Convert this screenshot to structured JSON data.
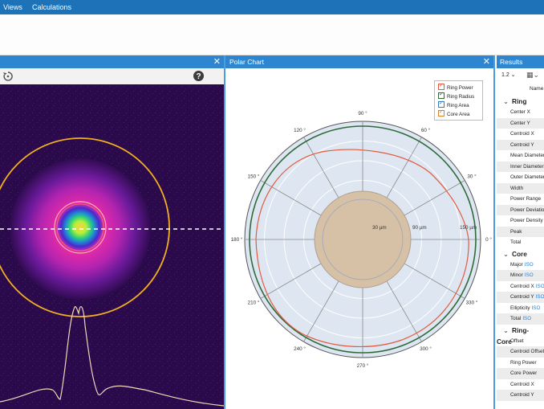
{
  "menu": {
    "items": [
      "Views",
      "Calculations"
    ]
  },
  "left_panel": {
    "close": "✕"
  },
  "polar_panel": {
    "title": "Polar Chart",
    "close": "✕",
    "legend": [
      {
        "label": "Ring Power",
        "color": "#e25b3f"
      },
      {
        "label": "Ring Radius",
        "color": "#2f6b3a"
      },
      {
        "label": "Ring Area",
        "color": "#3a78c2"
      },
      {
        "label": "Core Area",
        "color": "#d9822b"
      }
    ],
    "angle_labels": [
      "0 °",
      "30 °",
      "60 °",
      "90 °",
      "120 °",
      "150 °",
      "180 °",
      "210 °",
      "240 °",
      "270 °",
      "300 °",
      "330 °"
    ],
    "radial_labels": [
      "30 µm",
      "90 µm",
      "150 µm"
    ]
  },
  "results_panel": {
    "title": "Results",
    "version": "1.2",
    "column_header": "Name",
    "sections": [
      {
        "title": "Ring",
        "rows": [
          "Center X",
          "Center Y",
          "Centroid X",
          "Centroid Y",
          "Mean Diameter",
          "Inner Diameter",
          "Outer Diameter",
          "Width",
          "Power Range",
          "Power Deviation",
          "Power Density",
          "Peak",
          "Total"
        ]
      },
      {
        "title": "Core",
        "rows": [
          "Major",
          "Minor",
          "Centroid X",
          "Centroid Y",
          "Ellipticity",
          "Total"
        ],
        "iso": [
          "ISO",
          "ISO",
          "ISO",
          "ISO",
          "ISO",
          "ISO"
        ]
      },
      {
        "title": "Ring-Core",
        "rows": [
          "Offset",
          "Centroid Offset",
          "Ring Power",
          "Core Power",
          "Centroid X",
          "Centroid Y"
        ]
      }
    ]
  },
  "colors": {
    "accent": "#1e72b8",
    "panel_header": "#2d86cf",
    "beam_bg": "#2a0a4a",
    "ring_circle": "#f0b020"
  }
}
